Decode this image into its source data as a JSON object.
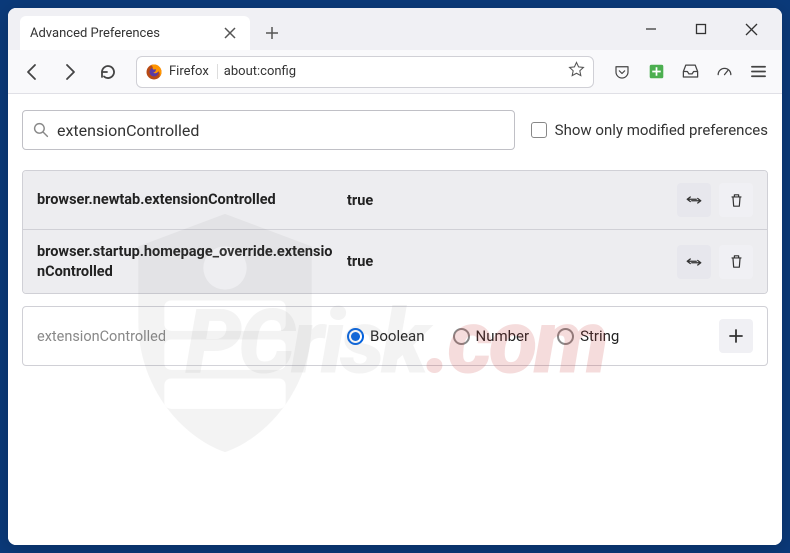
{
  "tab": {
    "title": "Advanced Preferences"
  },
  "urlbar": {
    "brand": "Firefox",
    "url": "about:config"
  },
  "search": {
    "value": "extensionControlled",
    "mod_only_label": "Show only modified preferences"
  },
  "prefs": [
    {
      "name": "browser.newtab.extensionControlled",
      "value": "true"
    },
    {
      "name": "browser.startup.homepage_override.extensionControlled",
      "value": "true"
    }
  ],
  "newpref": {
    "name": "extensionControlled",
    "types": {
      "boolean": "Boolean",
      "number": "Number",
      "string": "String"
    },
    "selected": "boolean"
  },
  "watermark": {
    "a": "PCrisk",
    "b": ".com"
  }
}
